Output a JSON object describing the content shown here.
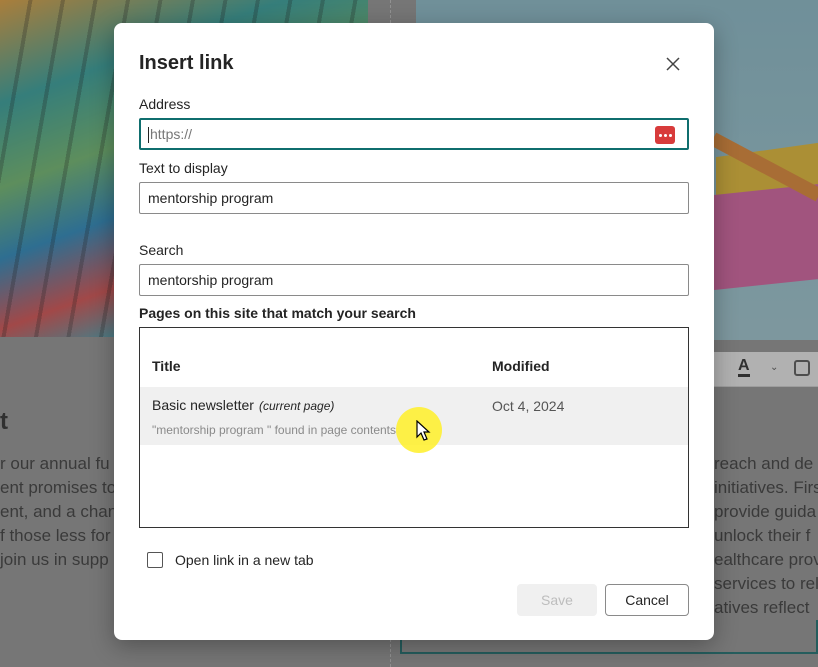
{
  "background": {
    "heading_fragment": "t",
    "left_text_lines": [
      "r our annual fu",
      "ent promises to",
      "ent, and a chan",
      "f those less for",
      "join us in supp"
    ],
    "right_text_lines": [
      "reach and de",
      "initiatives. Firs",
      "provide guida",
      "unlock their f",
      "ealthcare prov",
      "services to rel",
      "atives reflect"
    ],
    "toolbar_font_color_glyph": "A",
    "toolbar_chevron": "⌄"
  },
  "dialog": {
    "title": "Insert link",
    "address": {
      "label": "Address",
      "value": "",
      "placeholder": "https://"
    },
    "text_to_display": {
      "label": "Text to display",
      "value": "mentorship program"
    },
    "search": {
      "label": "Search",
      "value": "mentorship program"
    },
    "results": {
      "label": "Pages on this site that match your search",
      "columns": [
        "Title",
        "Modified"
      ],
      "rows": [
        {
          "title": "Basic newsletter",
          "tag": "(current page)",
          "found_text": "\"mentorship program \" found in page contents",
          "modified": "Oct 4, 2024"
        }
      ]
    },
    "open_new_tab": {
      "label": "Open link in a new tab",
      "checked": false
    },
    "buttons": {
      "save": "Save",
      "cancel": "Cancel"
    }
  },
  "colors": {
    "accent": "#0f6e6e",
    "password_icon": "#d83b3b",
    "cursor_highlight": "#fff028"
  }
}
